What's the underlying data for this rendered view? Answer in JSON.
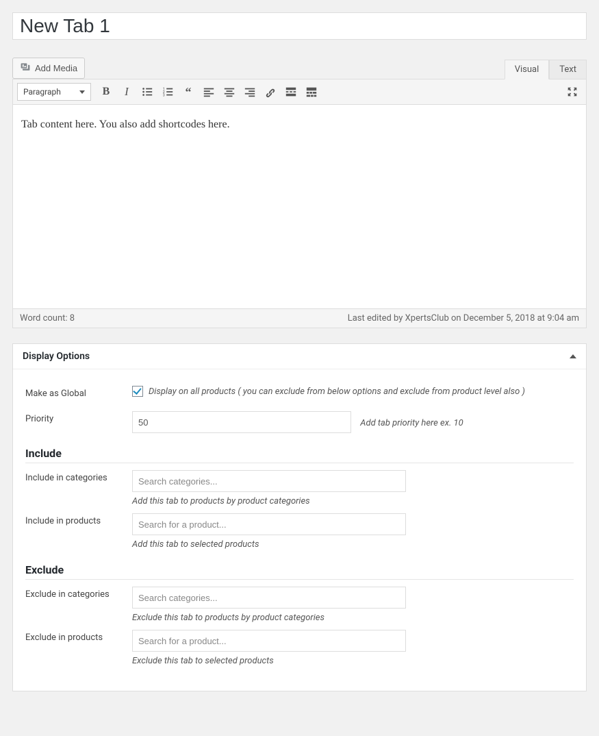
{
  "title": "New Tab 1",
  "add_media_label": "Add Media",
  "tabs": {
    "visual": "Visual",
    "text": "Text"
  },
  "format_selector": "Paragraph",
  "editor_body": "Tab content here. You also add shortcodes here.",
  "footer": {
    "word_count": "Word count: 8",
    "last_edited": "Last edited by XpertsClub on December 5, 2018 at 9:04 am"
  },
  "panel": {
    "title": "Display Options",
    "global": {
      "label": "Make as Global",
      "hint": "Display on all products ( you can exclude from below options and exclude from product level also )"
    },
    "priority": {
      "label": "Priority",
      "value": "50",
      "hint": "Add tab priority here ex. 10"
    },
    "include_title": "Include",
    "include_cat": {
      "label": "Include in categories",
      "placeholder": "Search categories...",
      "hint": "Add this tab to products by product categories"
    },
    "include_prod": {
      "label": "Include in products",
      "placeholder": "Search for a product...",
      "hint": "Add this tab to selected products"
    },
    "exclude_title": "Exclude",
    "exclude_cat": {
      "label": "Exclude in categories",
      "placeholder": "Search categories...",
      "hint": "Exclude this tab to products by product categories"
    },
    "exclude_prod": {
      "label": "Exclude in products",
      "placeholder": "Search for a product...",
      "hint": "Exclude this tab to selected products"
    }
  }
}
